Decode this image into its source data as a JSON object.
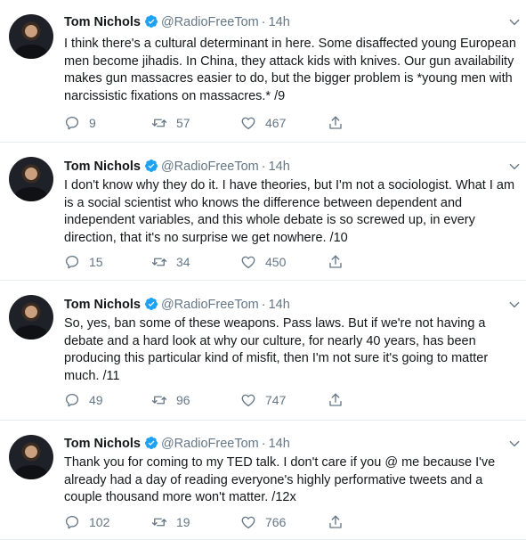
{
  "tweets": [
    {
      "name": "Tom Nichols",
      "handle": "@RadioFreeTom",
      "separator": "·",
      "time": "14h",
      "text": "I think there's a cultural determinant in here. Some disaffected young European men become jihadis. In China, they attack kids with knives. Our gun availability makes gun massacres easier to do, but the bigger problem is *young men with narcissistic fixations on massacres.* /9",
      "replies": "9",
      "retweets": "57",
      "likes": "467"
    },
    {
      "name": "Tom Nichols",
      "handle": "@RadioFreeTom",
      "separator": "·",
      "time": "14h",
      "text": "I don't know why they do it. I have theories, but I'm not a sociologist. What I am is a social scientist who knows the difference between dependent and independent variables, and this whole debate is so screwed up, in every direction, that it's no surprise we get nowhere. /10",
      "replies": "15",
      "retweets": "34",
      "likes": "450"
    },
    {
      "name": "Tom Nichols",
      "handle": "@RadioFreeTom",
      "separator": "·",
      "time": "14h",
      "text": "So, yes, ban some of these weapons. Pass laws. But if we're not having a debate and a hard look at why our culture, for nearly 40 years, has been producing this particular kind of misfit, then I'm not sure it's going to matter much. /11",
      "replies": "49",
      "retweets": "96",
      "likes": "747"
    },
    {
      "name": "Tom Nichols",
      "handle": "@RadioFreeTom",
      "separator": "·",
      "time": "14h",
      "text": "Thank you for coming to my TED talk. I don't care if you @ me because I've already had a day of reading everyone's highly performative tweets and a couple thousand more won't matter. /12x",
      "replies": "102",
      "retweets": "19",
      "likes": "766"
    }
  ],
  "colors": {
    "verified": "#1da1f2",
    "secondary_text": "#657786",
    "divider": "#e6ecf0"
  },
  "icons": [
    "verified-badge-icon",
    "chevron-down-icon",
    "reply-icon",
    "retweet-icon",
    "like-icon",
    "share-icon"
  ]
}
